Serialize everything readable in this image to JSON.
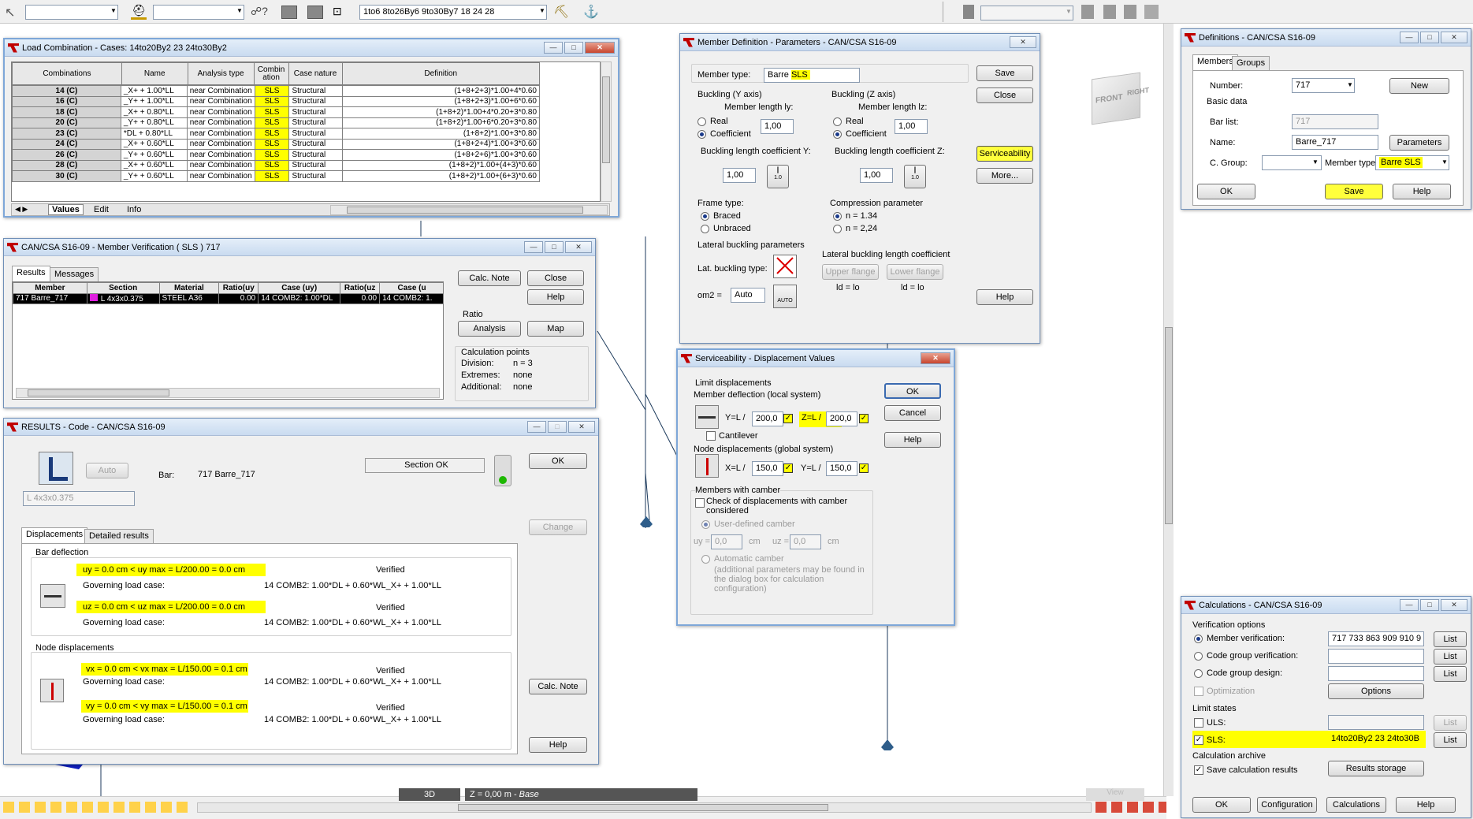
{
  "toolbar": {
    "combo_text": "1to6 8to26By6 9to30By7 18 24 28"
  },
  "view_footer": {
    "mode": "3D",
    "level": "Z = 0,00 m - ",
    "level_name": "Base",
    "view_label": "View"
  },
  "load_combination": {
    "title": "Load Combination - Cases:  14to20By2 23 24to30By2",
    "headers": [
      "Combinations",
      "Name",
      "Analysis type",
      "Combin ation",
      "Case nature",
      "Definition"
    ],
    "rows": [
      [
        "14 (C)",
        "_X+ + 1.00*LL",
        "near Combination",
        "SLS",
        "Structural",
        "(1+8+2+3)*1.00+4*0.60"
      ],
      [
        "16 (C)",
        "_Y+ + 1.00*LL",
        "near Combination",
        "SLS",
        "Structural",
        "(1+8+2+3)*1.00+6*0.60"
      ],
      [
        "18 (C)",
        "_X+ + 0.80*LL",
        "near Combination",
        "SLS",
        "Structural",
        "(1+8+2)*1.00+4*0.20+3*0.80"
      ],
      [
        "20 (C)",
        "_Y+ + 0.80*LL",
        "near Combination",
        "SLS",
        "Structural",
        "(1+8+2)*1.00+6*0.20+3*0.80"
      ],
      [
        "23 (C)",
        "*DL + 0.80*LL",
        "near Combination",
        "SLS",
        "Structural",
        "(1+8+2)*1.00+3*0.80"
      ],
      [
        "24 (C)",
        "_X+ + 0.60*LL",
        "near Combination",
        "SLS",
        "Structural",
        "(1+8+2+4)*1.00+3*0.60"
      ],
      [
        "26 (C)",
        "_Y+ + 0.60*LL",
        "near Combination",
        "SLS",
        "Structural",
        "(1+8+2+6)*1.00+3*0.60"
      ],
      [
        "28 (C)",
        "_X+ + 0.60*LL",
        "near Combination",
        "SLS",
        "Structural",
        "(1+8+2)*1.00+(4+3)*0.60"
      ],
      [
        "30 (C)",
        "_Y+ + 0.60*LL",
        "near Combination",
        "SLS",
        "Structural",
        "(1+8+2)*1.00+(6+3)*0.60"
      ]
    ],
    "tabs": [
      "Values",
      "Edit",
      "Info"
    ]
  },
  "member_verification": {
    "title": "CAN/CSA S16-09 - Member Verification ( SLS ) 717",
    "tabs": [
      "Results",
      "Messages"
    ],
    "headers": [
      "Member",
      "Section",
      "Material",
      "Ratio(uy",
      "Case (uy)",
      "Ratio(uz",
      "Case (u"
    ],
    "row": [
      "717  Barre_717",
      "L 4x3x0.375",
      "STEEL A36",
      "0.00",
      "14 COMB2: 1.00*DL",
      "0.00",
      "14 COMB2: 1."
    ],
    "buttons": {
      "calc_note": "Calc. Note",
      "close": "Close",
      "help": "Help",
      "analysis": "Analysis",
      "map": "Map"
    },
    "ratio_label": "Ratio",
    "calc_points": {
      "title": "Calculation points",
      "division_label": "Division:",
      "division": "n = 3",
      "extremes_label": "Extremes:",
      "extremes": "none",
      "additional_label": "Additional:",
      "additional": "none"
    }
  },
  "results": {
    "title": "RESULTS - Code - CAN/CSA S16-09",
    "auto": "Auto",
    "section_select": "L 4x3x0.375",
    "bar_label": "Bar:",
    "bar_value": "717  Barre_717",
    "section_ok": "Section OK",
    "ok": "OK",
    "change": "Change",
    "calc_note": "Calc. Note",
    "help": "Help",
    "tabs": [
      "Displacements",
      "Detailed results"
    ],
    "bar_deflection": "Bar deflection",
    "node_displacements": "Node displacements",
    "governing_label": "Governing load case:",
    "governing_value": "14 COMB2: 1.00*DL + 0.60*WL_X+ + 1.00*LL",
    "verified": "Verified",
    "uy": "uy = 0.0 cm  <  uy max = L/200.00 = 0.0 cm",
    "uz": "uz = 0.0 cm  <  uz max = L/200.00 = 0.0 cm",
    "vx": "vx = 0.0 cm  <  vx max = L/150.00 = 0.1 cm",
    "vy": "vy = 0.0 cm  <  vy max = L/150.00 = 0.1 cm"
  },
  "member_definition": {
    "title": "Member Definition - Parameters - CAN/CSA S16-09",
    "member_type_label": "Member type:",
    "member_type_prefix": "Barre ",
    "member_type_hl": "SLS",
    "buckling_y": "Buckling (Y axis)",
    "buckling_z": "Buckling (Z axis)",
    "len_ly": "Member length ly:",
    "len_lz": "Member length lz:",
    "real": "Real",
    "coefficient": "Coefficient",
    "val_1": "1,00",
    "blc_y": "Buckling length coefficient Y:",
    "blc_z": "Buckling length coefficient Z:",
    "frame_type": "Frame type:",
    "braced": "Braced",
    "unbraced": "Unbraced",
    "compression": "Compression parameter",
    "n134": "n = 1.34",
    "n224": "n = 2,24",
    "lateral": "Lateral buckling parameters",
    "lat_type": "Lat. buckling type:",
    "lat_coef": "Lateral buckling length coefficient",
    "upper": "Upper flange",
    "lower": "Lower flange",
    "lo1": "ld = lo",
    "lo2": "ld = lo",
    "om2": "om2 =",
    "om2_value": "Auto",
    "auto_icon": "AUTO",
    "coef_icon": "1.0",
    "buttons": {
      "save": "Save",
      "close": "Close",
      "serviceability": "Serviceability",
      "more": "More...",
      "help": "Help"
    }
  },
  "serviceability": {
    "title": "Serviceability - Displacement Values",
    "limit": "Limit displacements",
    "member_defl": "Member deflection (local system)",
    "y_label": "Y=L /",
    "z_label": "Z=L /",
    "y_value": "200,0",
    "z_value": "200,0",
    "cantilever": "Cantilever",
    "node_disp": "Node displacements (global system)",
    "x_label": "X=L /",
    "y2_label": "Y=L /",
    "x_value": "150,0",
    "y2_value": "150,0",
    "camber": "Members with camber",
    "check_camber": "Check of displacements with camber considered",
    "user_camber": "User-defined camber",
    "uy": "uy =",
    "uz": "uz =",
    "zero": "0,0",
    "cm": "cm",
    "auto_camber": "Automatic camber",
    "note": "(additional parameters may be found in the dialog box for calculation configuration)",
    "buttons": {
      "ok": "OK",
      "cancel": "Cancel",
      "help": "Help"
    }
  },
  "definitions": {
    "title": "Definitions - CAN/CSA S16-09",
    "tabs": [
      "Members",
      "Groups"
    ],
    "number_label": "Number:",
    "number": "717",
    "new": "New",
    "basic": "Basic data",
    "bar_list_label": "Bar list:",
    "bar_list": "717",
    "name_label": "Name:",
    "name": "Barre_717",
    "parameters": "Parameters",
    "cgroup": "C. Group:",
    "member_type_label": "Member type:",
    "member_type": "Barre SLS",
    "ok": "OK",
    "save": "Save",
    "help": "Help"
  },
  "calculations": {
    "title": "Calculations - CAN/CSA S16-09",
    "verif_options": "Verification options",
    "member_verif": "Member verification:",
    "member_list": "717 733 863 909 910 9",
    "code_group_verif": "Code group verification:",
    "code_group_design": "Code group design:",
    "optimization": "Optimization",
    "options": "Options",
    "limit_states": "Limit states",
    "uls": "ULS:",
    "sls": "SLS:",
    "sls_value": "14to20By2 23 24to30B",
    "list": "List",
    "archive": "Calculation archive",
    "save_results": "Save calculation results",
    "results_storage": "Results storage",
    "ok": "OK",
    "configuration": "Configuration",
    "calculations_btn": "Calculations",
    "help": "Help"
  },
  "viewcube": {
    "front": "FRONT",
    "right": "RIGHT"
  }
}
